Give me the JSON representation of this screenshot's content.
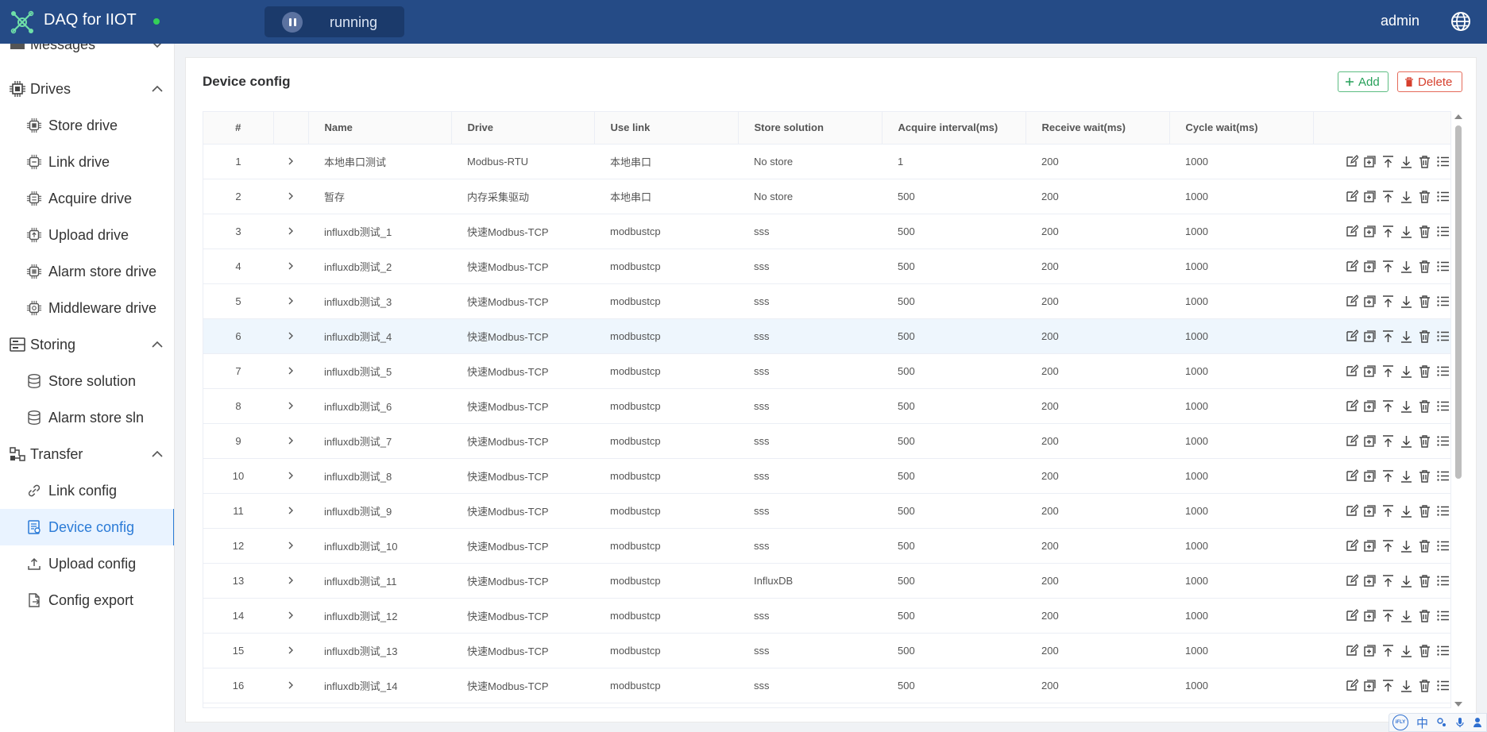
{
  "header": {
    "app_title": "DAQ for IIOT",
    "status_label": "running",
    "user": "admin",
    "colors": {
      "bar": "#254b86",
      "status_dot": "#34d058"
    }
  },
  "sidebar": {
    "partial_top": {
      "label": "Messages",
      "icon": "message-icon"
    },
    "groups": [
      {
        "label": "Drives",
        "icon": "chip-icon",
        "items": [
          "Store drive",
          "Link drive",
          "Acquire drive",
          "Upload drive",
          "Alarm store drive",
          "Middleware drive"
        ]
      },
      {
        "label": "Storing",
        "icon": "server-icon",
        "items": [
          "Store solution",
          "Alarm store sln"
        ]
      },
      {
        "label": "Transfer",
        "icon": "flow-icon",
        "items": [
          "Link config",
          "Device config",
          "Upload config",
          "Config export"
        ]
      }
    ],
    "active": "Device config"
  },
  "main": {
    "title": "Device config",
    "add_label": "Add",
    "delete_label": "Delete"
  },
  "table": {
    "headers": [
      "#",
      "",
      "Name",
      "Drive",
      "Use link",
      "Store solution",
      "Acquire interval(ms)",
      "Receive wait(ms)",
      "Cycle wait(ms)",
      ""
    ],
    "rows": [
      [
        "1",
        "本地串口测试",
        "Modbus-RTU",
        "本地串口",
        "No store",
        "1",
        "200",
        "1000"
      ],
      [
        "2",
        "暂存",
        "内存采集驱动",
        "本地串口",
        "No store",
        "500",
        "200",
        "1000"
      ],
      [
        "3",
        "influxdb测试_1",
        "快速Modbus-TCP",
        "modbustcp",
        "sss",
        "500",
        "200",
        "1000"
      ],
      [
        "4",
        "influxdb测试_2",
        "快速Modbus-TCP",
        "modbustcp",
        "sss",
        "500",
        "200",
        "1000"
      ],
      [
        "5",
        "influxdb测试_3",
        "快速Modbus-TCP",
        "modbustcp",
        "sss",
        "500",
        "200",
        "1000"
      ],
      [
        "6",
        "influxdb测试_4",
        "快速Modbus-TCP",
        "modbustcp",
        "sss",
        "500",
        "200",
        "1000"
      ],
      [
        "7",
        "influxdb测试_5",
        "快速Modbus-TCP",
        "modbustcp",
        "sss",
        "500",
        "200",
        "1000"
      ],
      [
        "8",
        "influxdb测试_6",
        "快速Modbus-TCP",
        "modbustcp",
        "sss",
        "500",
        "200",
        "1000"
      ],
      [
        "9",
        "influxdb测试_7",
        "快速Modbus-TCP",
        "modbustcp",
        "sss",
        "500",
        "200",
        "1000"
      ],
      [
        "10",
        "influxdb测试_8",
        "快速Modbus-TCP",
        "modbustcp",
        "sss",
        "500",
        "200",
        "1000"
      ],
      [
        "11",
        "influxdb测试_9",
        "快速Modbus-TCP",
        "modbustcp",
        "sss",
        "500",
        "200",
        "1000"
      ],
      [
        "12",
        "influxdb测试_10",
        "快速Modbus-TCP",
        "modbustcp",
        "sss",
        "500",
        "200",
        "1000"
      ],
      [
        "13",
        "influxdb测试_11",
        "快速Modbus-TCP",
        "modbustcp",
        "InfluxDB",
        "500",
        "200",
        "1000"
      ],
      [
        "14",
        "influxdb测试_12",
        "快速Modbus-TCP",
        "modbustcp",
        "sss",
        "500",
        "200",
        "1000"
      ],
      [
        "15",
        "influxdb测试_13",
        "快速Modbus-TCP",
        "modbustcp",
        "sss",
        "500",
        "200",
        "1000"
      ],
      [
        "16",
        "influxdb测试_14",
        "快速Modbus-TCP",
        "modbustcp",
        "sss",
        "500",
        "200",
        "1000"
      ]
    ],
    "highlighted_row": "6",
    "row_actions": [
      "edit-icon",
      "copy-add-icon",
      "move-top-icon",
      "download-icon",
      "trash-icon",
      "list-icon"
    ]
  },
  "ime": {
    "badge": "iFLY",
    "lang": "中"
  }
}
